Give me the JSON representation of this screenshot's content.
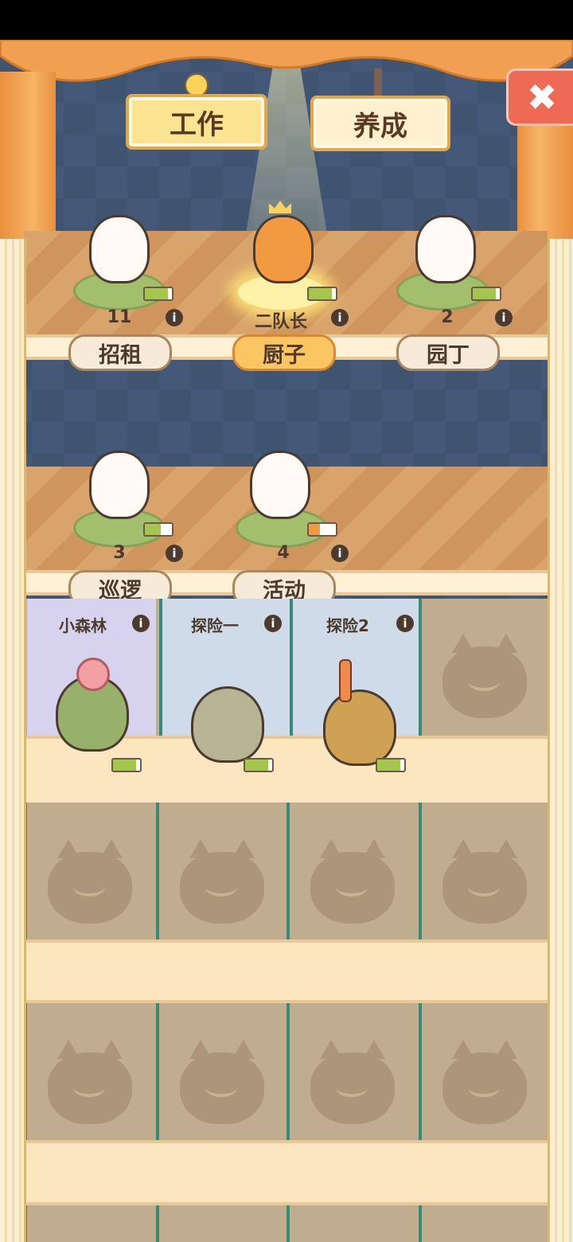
{
  "tabs": {
    "work_label": "工作",
    "raise_label": "养成",
    "active": "工作"
  },
  "close_button": {
    "icon": "close-icon",
    "color": "#ee6a54"
  },
  "shelf_top": {
    "slots": [
      {
        "number": "11",
        "job": "招租",
        "active": false,
        "battery": 0.85
      },
      {
        "number": "二队长",
        "job": "厨子",
        "active": true,
        "battery": 0.85
      },
      {
        "number": "2",
        "job": "园丁",
        "active": false,
        "battery": 0.85
      }
    ]
  },
  "shelf_second": {
    "slots": [
      {
        "number": "3",
        "job": "巡逻",
        "battery": 0.6
      },
      {
        "number": "4",
        "job": "活动",
        "battery": 0.4
      }
    ]
  },
  "expeditions": [
    {
      "label": "小森林",
      "battery": 0.85
    },
    {
      "label": "探险一",
      "battery": 0.85
    },
    {
      "label": "探险2",
      "battery": 0.85
    }
  ],
  "info_glyph": "i"
}
